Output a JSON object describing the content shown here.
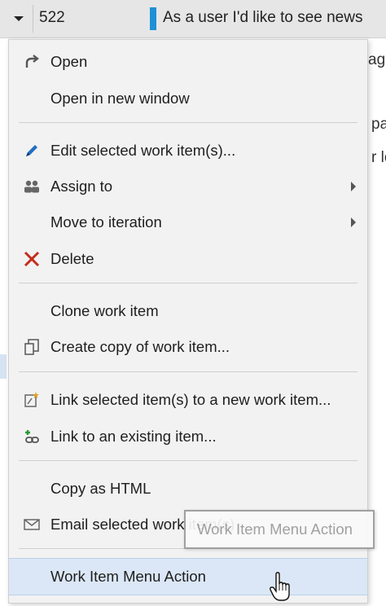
{
  "grid": {
    "row": {
      "id": "522",
      "title": "As a user I'd like to see news",
      "color_bar": "#1e90d6"
    },
    "background_fragments": [
      "age",
      "pa",
      "r lo"
    ]
  },
  "menu": {
    "items": [
      {
        "label": "Open",
        "icon": "redo-arrow-icon"
      },
      {
        "label": "Open in new window",
        "icon": ""
      },
      {
        "label": "Edit selected work item(s)...",
        "icon": "pencil-icon"
      },
      {
        "label": "Assign to",
        "icon": "people-icon",
        "submenu": true
      },
      {
        "label": "Move to iteration",
        "icon": "",
        "submenu": true
      },
      {
        "label": "Delete",
        "icon": "delete-x-icon",
        "color": "#c42b1c"
      },
      {
        "label": "Clone work item",
        "icon": ""
      },
      {
        "label": "Create copy of work item...",
        "icon": "copy-icon"
      },
      {
        "label": "Link selected item(s) to a new work item...",
        "icon": "new-link-icon"
      },
      {
        "label": "Link to an existing item...",
        "icon": "link-icon"
      },
      {
        "label": "Copy as HTML",
        "icon": ""
      },
      {
        "label": "Email selected work item(s)",
        "icon": "mail-icon"
      },
      {
        "label": "Work Item Menu Action",
        "icon": "",
        "highlighted": true
      }
    ]
  },
  "tooltip": {
    "text": "Work Item Menu Action"
  },
  "colors": {
    "menu_bg": "#f2f2f2",
    "highlight": "#dbe7f6",
    "accent": "#1e90d6",
    "delete": "#c42b1c"
  }
}
